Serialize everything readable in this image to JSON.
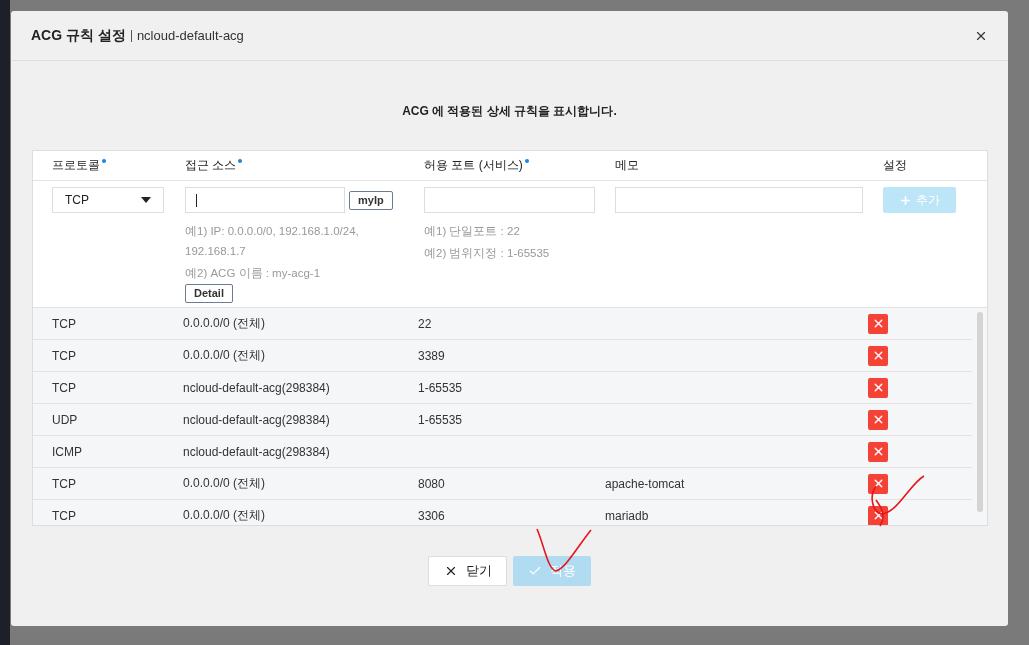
{
  "dialog": {
    "title": "ACG 규칙 설정",
    "subtitle": "ncloud-default-acg",
    "description": "ACG 에 적용된 상세 규칙을 표시합니다."
  },
  "columns": [
    {
      "label": "프로토콜",
      "required": true
    },
    {
      "label": "접근 소스",
      "required": true
    },
    {
      "label": "허용 포트 (서비스)",
      "required": true
    },
    {
      "label": "메모",
      "required": false
    },
    {
      "label": "설정",
      "required": false
    }
  ],
  "new_rule": {
    "protocol": "TCP",
    "source": {
      "focused": true,
      "button": "myIp",
      "hints": [
        "예1) IP: 0.0.0.0/0, 192.168.1.0/24, 192.168.1.7",
        "예2) ACG 이름 : my-acg-1"
      ],
      "detail_button": "Detail"
    },
    "port": {
      "hints": [
        "예1) 단일포트 : 22",
        "예2) 범위지정 : 1-65535"
      ]
    },
    "add_button": {
      "label": "추가",
      "disabled": true
    }
  },
  "rules": [
    {
      "protocol": "TCP",
      "source": "0.0.0.0/0 (전체)",
      "port": "22"
    },
    {
      "protocol": "TCP",
      "source": "0.0.0.0/0 (전체)",
      "port": "3389"
    },
    {
      "protocol": "TCP",
      "source": "ncloud-default-acg(298384)",
      "port": "1-65535"
    },
    {
      "protocol": "UDP",
      "source": "ncloud-default-acg(298384)",
      "port": "1-65535"
    },
    {
      "protocol": "ICMP",
      "source": "ncloud-default-acg(298384)"
    },
    {
      "protocol": "TCP",
      "source": "0.0.0.0/0 (전체)",
      "port": "8080",
      "memo": "apache-tomcat"
    },
    {
      "protocol": "TCP",
      "source": "0.0.0.0/0 (전체)",
      "port": "3306",
      "memo": "mariadb"
    }
  ],
  "footer": {
    "close_button": "닫기",
    "apply_button": {
      "label": "적용",
      "disabled": true
    }
  }
}
